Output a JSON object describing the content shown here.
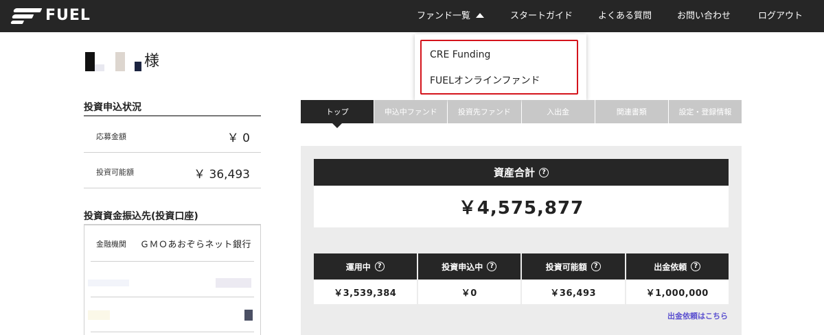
{
  "header": {
    "logo_text": "FUEL",
    "nav": {
      "fund_list": "ファンド一覧",
      "start_guide": "スタートガイド",
      "faq": "よくある質問",
      "contact": "お問い合わせ",
      "logout": "ログアウト"
    }
  },
  "dropdown": {
    "items": [
      "CRE Funding",
      "FUELオンラインファンド"
    ],
    "highlight_color": "#d4131b"
  },
  "user": {
    "suffix": "様"
  },
  "left": {
    "status_title": "投資申込状況",
    "application_amount_label": "応募金額",
    "application_amount_value": "￥ 0",
    "investable_label": "投資可能額",
    "investable_value": "￥ 36,493",
    "bank_title": "投資資金振込先(投資口座)",
    "bank_institution_label": "金融機関",
    "bank_institution_value": "ＧＭＯあおぞらネット銀行"
  },
  "tabs": [
    "トップ",
    "申込中ファンド",
    "投資先ファンド",
    "入出金",
    "関連書類",
    "設定・登録情報"
  ],
  "asset": {
    "title": "資産合計",
    "help": "?",
    "value": "￥4,575,877"
  },
  "stats": [
    {
      "label": "運用中",
      "value": "￥3,539,384"
    },
    {
      "label": "投資申込中",
      "value": "￥0"
    },
    {
      "label": "投資可能額",
      "value": "￥36,493"
    },
    {
      "label": "出金依頼",
      "value": "￥1,000,000"
    }
  ],
  "withdraw_link": "出金依頼はこちら",
  "colors": {
    "header_bg": "#262626",
    "tab_inactive": "#c8c8c8",
    "link": "#5a4fcf"
  }
}
